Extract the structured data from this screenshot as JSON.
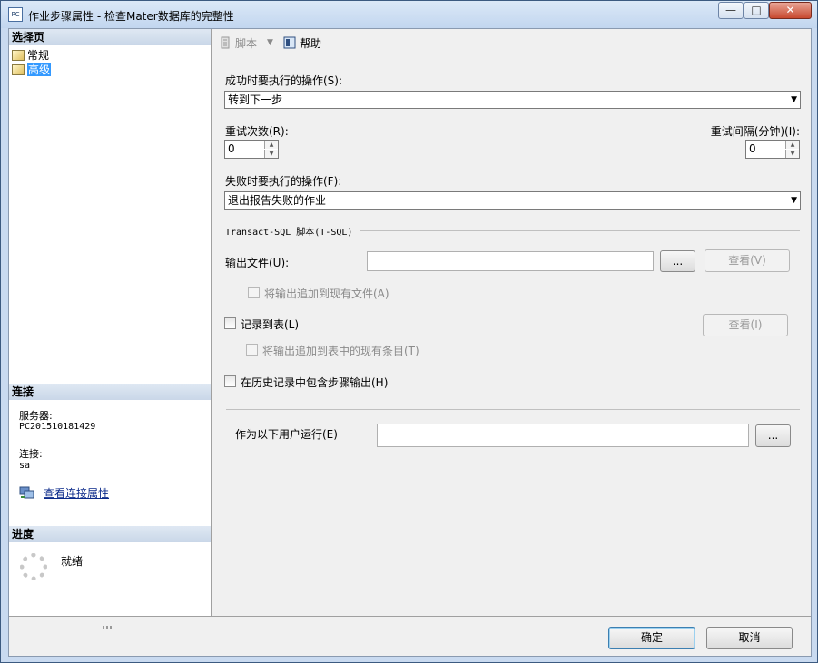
{
  "window": {
    "title": "作业步骤属性 - 检查Mater数据库的完整性",
    "icon_text": "PC",
    "buttons": {
      "minimize": "—",
      "maximize": "□",
      "close": "✕"
    }
  },
  "left_panel": {
    "select_page_header": "选择页",
    "pages": [
      {
        "label": "常规",
        "icon": "page-icon",
        "selected": false
      },
      {
        "label": "高级",
        "icon": "page-icon",
        "selected": true
      }
    ],
    "connection_header": "连接",
    "server_label": "服务器:",
    "server_value": "PC201510181429",
    "connection_label": "连接:",
    "connection_value": "sa",
    "view_connection_properties": "查看连接属性",
    "progress_header": "进度",
    "progress_status": "就绪"
  },
  "toolbar": {
    "script_label": "脚本",
    "help_label": "帮助"
  },
  "form": {
    "on_success_label": "成功时要执行的操作(S):",
    "on_success_value": "转到下一步",
    "retry_attempts_label": "重试次数(R):",
    "retry_attempts_value": "0",
    "retry_interval_label": "重试间隔(分钟)(I):",
    "retry_interval_value": "0",
    "on_failure_label": "失败时要执行的操作(F):",
    "on_failure_value": "退出报告失败的作业",
    "tsql_group_label": "Transact-SQL 脚本(T-SQL)",
    "output_file_label": "输出文件(U):",
    "output_file_value": "",
    "browse_button": "...",
    "view_output_button": "查看(V)",
    "append_output_file_label": "将输出追加到现有文件(A)",
    "log_to_table_label": "记录到表(L)",
    "view_table_button": "查看(I)",
    "append_to_table_label": "将输出追加到表中的现有条目(T)",
    "include_history_label": "在历史记录中包含步骤输出(H)",
    "run_as_label": "作为以下用户运行(E)",
    "run_as_value": "",
    "run_as_browse_button": "..."
  },
  "footer": {
    "ok_button": "确定",
    "cancel_button": "取消"
  }
}
